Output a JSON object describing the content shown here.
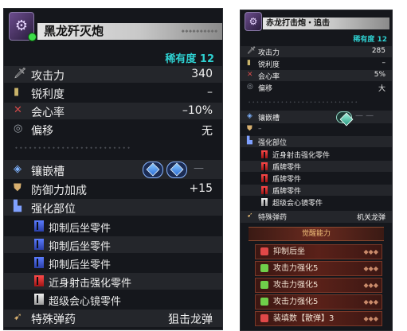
{
  "left": {
    "weapon_name": "黑龙歼灭炮",
    "rarity": "稀有度 12",
    "stats": [
      {
        "label": "攻击力",
        "value": "340",
        "icon": "attack-icon"
      },
      {
        "label": "锐利度",
        "value": "–",
        "icon": "sharpness-icon"
      },
      {
        "label": "会心率",
        "value": "–10%",
        "icon": "affinity-icon"
      },
      {
        "label": "偏移",
        "value": "无",
        "icon": "deviation-icon"
      }
    ],
    "slots_label": "镶嵌槽",
    "slots_empty": "—",
    "defense_label": "防御力加成",
    "defense_value": "+15",
    "custom_label": "强化部位",
    "parts": [
      {
        "label": "抑制后坐零件",
        "color": "blue"
      },
      {
        "label": "抑制后坐零件",
        "color": "blue"
      },
      {
        "label": "抑制后坐零件",
        "color": "blue"
      },
      {
        "label": "近身射击强化零件",
        "color": "red"
      },
      {
        "label": "超级会心镜零件",
        "color": "white"
      }
    ],
    "special_ammo_label": "特殊弹药",
    "special_ammo_value": "狙击龙弹"
  },
  "right": {
    "weapon_name": "赤龙打击炮・追击",
    "rarity": "稀有度 12",
    "stats": [
      {
        "label": "攻击力",
        "value": "285"
      },
      {
        "label": "锐利度",
        "value": "–"
      },
      {
        "label": "会心率",
        "value": "5%"
      },
      {
        "label": "偏移",
        "value": "大"
      }
    ],
    "slots_label": "镶嵌槽",
    "slots_empty": "— —",
    "defense_dash": "–",
    "custom_label": "强化部位",
    "parts": [
      {
        "label": "近身射击强化零件",
        "color": "red"
      },
      {
        "label": "盾牌零件",
        "color": "red"
      },
      {
        "label": "盾牌零件",
        "color": "red"
      },
      {
        "label": "盾牌零件",
        "color": "red"
      },
      {
        "label": "超级会心镜零件",
        "color": "white"
      }
    ],
    "special_ammo_label": "特殊弹药",
    "special_ammo_value": "机关龙弹",
    "awakened_title": "觉醒能力",
    "awakened": [
      {
        "label": "抑制后坐",
        "icon": "red"
      },
      {
        "label": "攻击力强化5",
        "icon": "green"
      },
      {
        "label": "攻击力强化5",
        "icon": "green"
      },
      {
        "label": "攻击力强化5",
        "icon": "green"
      },
      {
        "label": "装填数【散弹】3",
        "icon": "red"
      }
    ]
  },
  "colors": {
    "rarity": "#2ed0d0",
    "panel_bg": "#15171c",
    "accent_blue": "#5b7dff",
    "accent_red": "#ff4b4b"
  }
}
